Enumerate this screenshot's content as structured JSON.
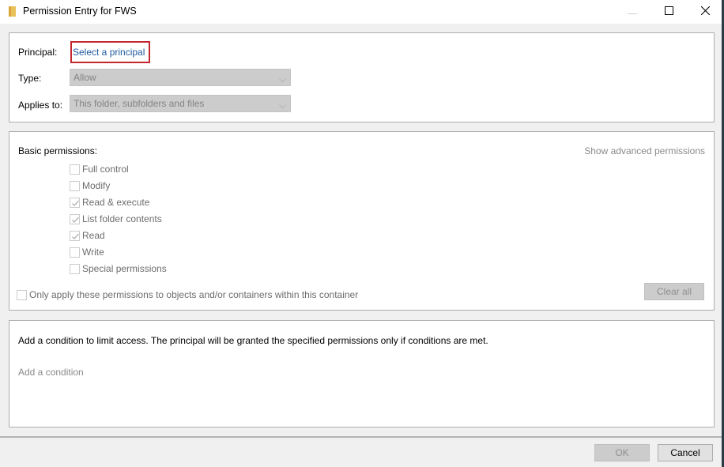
{
  "window": {
    "title": "Permission Entry for FWS",
    "icon": "folder-icon",
    "controls": {
      "minimize": "minimize-icon",
      "maximize": "maximize-icon",
      "close": "close-icon"
    }
  },
  "principal_section": {
    "principal_label": "Principal:",
    "principal_link": "Select a principal",
    "highlight_color": "#c4262e",
    "link_color": "#1e5aa0",
    "type_label": "Type:",
    "type_value": "Allow",
    "applies_label": "Applies to:",
    "applies_value": "This folder, subfolders and files"
  },
  "permissions_section": {
    "heading": "Basic permissions:",
    "advanced_link": "Show advanced permissions",
    "items": [
      {
        "label": "Full control",
        "checked": false
      },
      {
        "label": "Modify",
        "checked": false
      },
      {
        "label": "Read & execute",
        "checked": true
      },
      {
        "label": "List folder contents",
        "checked": true
      },
      {
        "label": "Read",
        "checked": true
      },
      {
        "label": "Write",
        "checked": false
      },
      {
        "label": "Special permissions",
        "checked": false
      }
    ],
    "only_apply_label": "Only apply these permissions to objects and/or containers within this container",
    "only_apply_checked": false,
    "clear_all": "Clear all"
  },
  "condition_section": {
    "description": "Add a condition to limit access. The principal will be granted the specified permissions only if conditions are met.",
    "add_condition": "Add a condition"
  },
  "footer": {
    "ok": "OK",
    "cancel": "Cancel"
  }
}
